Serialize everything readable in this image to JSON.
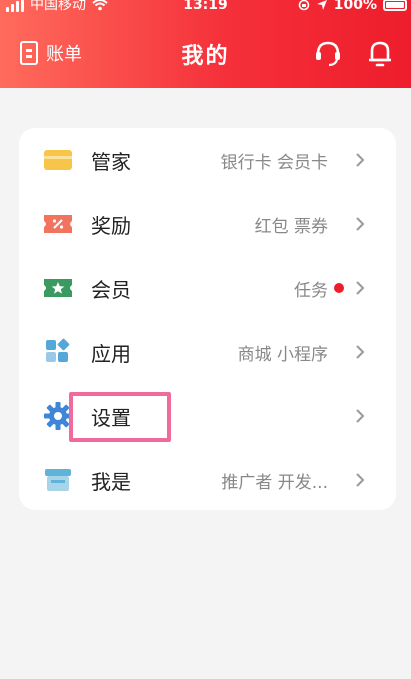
{
  "status_bar": {
    "carrier": "中国移动",
    "time": "13:19",
    "battery": "100%"
  },
  "header": {
    "left_label": "账单",
    "title": "我的"
  },
  "menu": [
    {
      "id": "butler",
      "label": "管家",
      "hint": "银行卡 会员卡",
      "icon": "card-icon",
      "color": "#f7c54a"
    },
    {
      "id": "rewards",
      "label": "奖励",
      "hint": "红包 票券",
      "icon": "coupon-icon",
      "color": "#f2735e"
    },
    {
      "id": "member",
      "label": "会员",
      "hint": "任务",
      "icon": "star-ticket-icon",
      "color": "#3a9a60",
      "badge": true
    },
    {
      "id": "apps",
      "label": "应用",
      "hint": "商城 小程序",
      "icon": "apps-grid-icon",
      "color": "#53a8d8"
    },
    {
      "id": "settings",
      "label": "设置",
      "hint": "",
      "icon": "gear-icon",
      "color": "#3f86d8"
    },
    {
      "id": "iam",
      "label": "我是",
      "hint": "推广者 开发...",
      "icon": "store-icon",
      "color": "#5fb3d8"
    }
  ],
  "colors": {
    "header_start": "#ff6b5c",
    "header_end": "#ee1d2c",
    "highlight": "#f06b9b",
    "badge": "#ee1d2c"
  }
}
